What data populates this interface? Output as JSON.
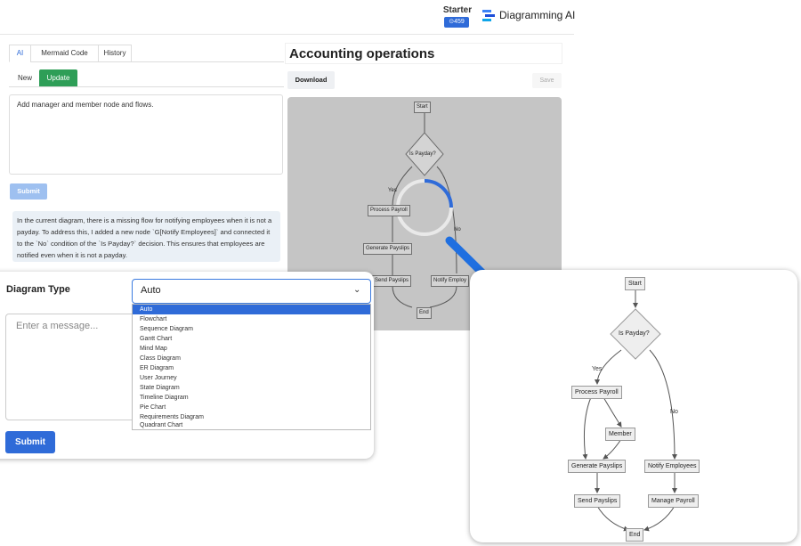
{
  "header": {
    "plan": "Starter",
    "credits": "⊙459",
    "brand": "Diagramming AI"
  },
  "tabs": [
    "AI",
    "Mermaid Code",
    "History"
  ],
  "subtabs": [
    "New",
    "Update"
  ],
  "prompt_text": "Add manager and member node and flows.",
  "submit_label": "Submit",
  "ai_message": "In the current diagram, there is a missing flow for notifying employees when it is not a payday. To address this, I added a new node `G[Notify Employees]` and connected it to the `No` condition of the `Is Payday?` decision. This ensures that employees are notified even when it is not a payday.",
  "preview": {
    "title": "Accounting operations",
    "download": "Download",
    "save": "Save",
    "nodes": {
      "start": "Start",
      "decision": "Is Payday?",
      "process": "Process Payroll",
      "generate": "Generate Payslips",
      "send": "Send Payslips",
      "notify": "Notify Employ",
      "end": "End"
    },
    "labels": {
      "yes": "Yes",
      "no": "No"
    }
  },
  "diagram_type": {
    "label": "Diagram Type",
    "selected": "Auto",
    "options": [
      "Auto",
      "Flowchart",
      "Sequence Diagram",
      "Gantt Chart",
      "Mind Map",
      "Class Diagram",
      "ER Diagram",
      "User Journey",
      "State Diagram",
      "Timeline Diagram",
      "Pie Chart",
      "Requirements Diagram",
      "Quadrant Chart"
    ]
  },
  "message_placeholder": "Enter a message...",
  "submit2_label": "Submit",
  "zoomed": {
    "nodes": {
      "start": "Start",
      "decision": "Is Payday?",
      "process": "Process Payroll",
      "member": "Member",
      "generate": "Generate Payslips",
      "notify": "Notify Employees",
      "send": "Send Payslips",
      "manage": "Manage Payroll",
      "end": "End"
    },
    "labels": {
      "yes": "Yes",
      "no": "No"
    }
  },
  "colors": {
    "accent": "#2f6bd8",
    "update_tab": "#2e9e57",
    "arrow": "#1f6fe0"
  }
}
